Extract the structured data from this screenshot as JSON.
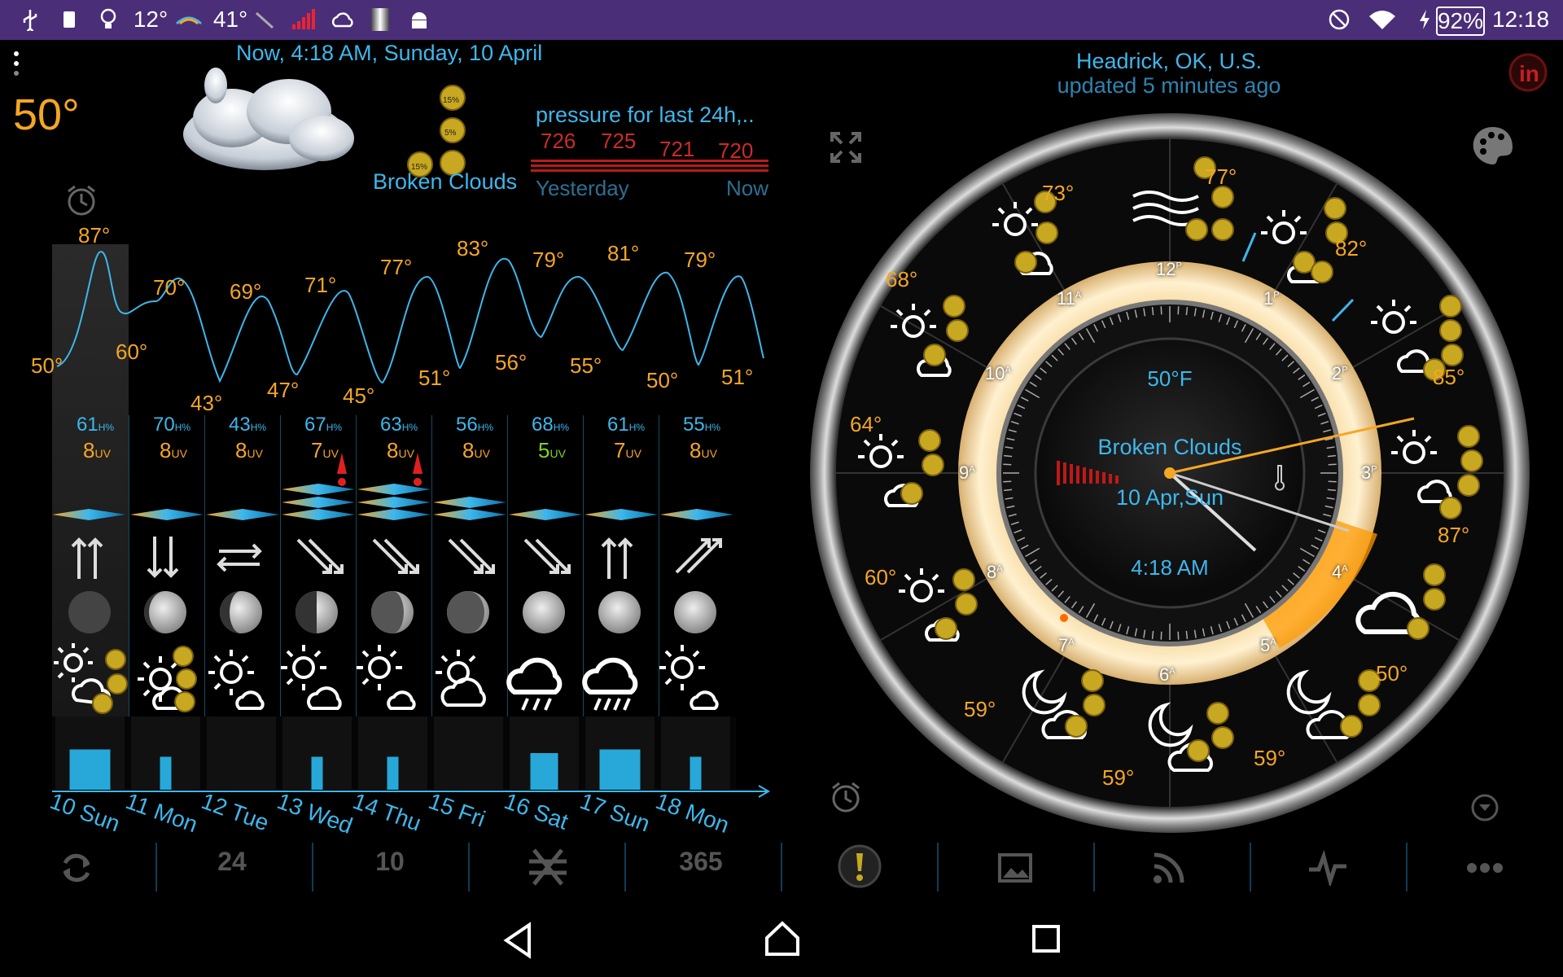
{
  "status_bar": {
    "temp_12": "12°",
    "temp_41": "41°",
    "battery": "92%",
    "clock": "12:18"
  },
  "current": {
    "time_line": "Now, 4:18 AM, Sunday, 10 April",
    "temperature": "50°",
    "condition": "Broken Clouds"
  },
  "pressure": {
    "title": "pressure for last 24h,..",
    "values": [
      "726",
      "725",
      "721",
      "720"
    ],
    "from_label": "Yesterday",
    "to_label": "Now"
  },
  "location": {
    "name": "Headrick, OK, U.S.",
    "updated": "updated 5 minutes ago"
  },
  "forecast": {
    "high_labels": [
      "87°",
      "70°",
      "69°",
      "71°",
      "77°",
      "83°",
      "79°",
      "81°",
      "79°"
    ],
    "low_labels": [
      "50°",
      "60°",
      "43°",
      "47°",
      "45°",
      "51°",
      "56°",
      "55°",
      "50°",
      "51°"
    ],
    "days": [
      {
        "label": "10 Sun",
        "humidity": "61",
        "uv": "8",
        "rain": 0.55
      },
      {
        "label": "11 Mon",
        "humidity": "70",
        "uv": "8",
        "rain": 0.45
      },
      {
        "label": "12 Tue",
        "humidity": "43",
        "uv": "8",
        "rain": 0.0
      },
      {
        "label": "13 Wed",
        "humidity": "67",
        "uv": "7",
        "rain": 0.45
      },
      {
        "label": "14 Thu",
        "humidity": "63",
        "uv": "8",
        "rain": 0.45
      },
      {
        "label": "15 Fri",
        "humidity": "56",
        "uv": "8",
        "rain": 0.0
      },
      {
        "label": "16 Sat",
        "humidity": "68",
        "uv": "5",
        "rain": 0.5
      },
      {
        "label": "17 Sun",
        "humidity": "61",
        "uv": "7",
        "rain": 0.55
      },
      {
        "label": "18 Mon",
        "humidity": "55",
        "uv": "8",
        "rain": 0.45
      }
    ]
  },
  "clock": {
    "temp": "50°F",
    "condition": "Broken Clouds",
    "date": "10 Apr,Sun",
    "time": "4:18 AM",
    "hour_labels": [
      "12",
      "1",
      "2",
      "3",
      "4",
      "5",
      "6",
      "7",
      "8",
      "9",
      "10",
      "11"
    ],
    "hour_suffix": [
      "P",
      "P",
      "P",
      "P",
      "A",
      "A",
      "A",
      "A",
      "A",
      "A",
      "A",
      "A"
    ],
    "ring_temps": [
      "77°",
      "82°",
      "85°",
      "87°",
      "50°",
      "59°",
      "59°",
      "59°",
      "60°",
      "64°",
      "68°",
      "73°"
    ]
  },
  "bottom_bar": {
    "item_24": "24",
    "item_10": "10",
    "item_365": "365"
  },
  "icons": {
    "usb": "usb-icon",
    "alarm": "alarm-icon",
    "palette": "palette-icon",
    "expand": "expand-icon",
    "refresh": "refresh-icon",
    "more": "more-icon"
  },
  "colors": {
    "accent": "#3db7ec",
    "temperature": "#f5a623",
    "pressure": "#cc2a2a",
    "statusbar": "#4a2e78"
  }
}
